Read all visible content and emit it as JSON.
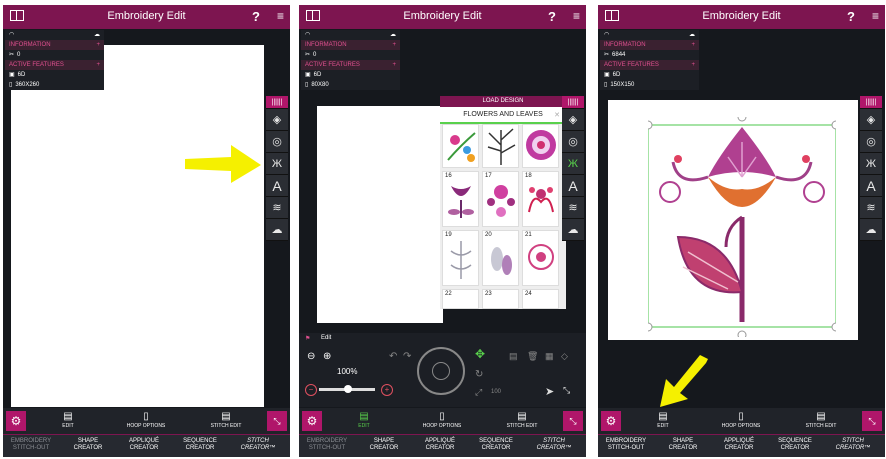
{
  "app": {
    "title": "Embroidery Edit",
    "help": "?",
    "menu": "≡"
  },
  "info_panel": {
    "information_label": "INFORMATION",
    "active_features_label": "ACTIVE FEATURES",
    "screens": [
      {
        "stitches": "0",
        "hoop_feature": "6D",
        "hoop_size": "360X260"
      },
      {
        "stitches": "0",
        "hoop_feature": "6D",
        "hoop_size": "80X80"
      },
      {
        "stitches": "6844",
        "hoop_feature": "6D",
        "hoop_size": "150X150"
      }
    ]
  },
  "load_design": {
    "header": "LOAD DESIGN",
    "category": "FLOWERS AND LEAVES",
    "cells": [
      "16",
      "17",
      "18",
      "19",
      "20",
      "21",
      "22",
      "23",
      "24"
    ]
  },
  "edit_panel": {
    "label": "Edit",
    "zoom": "100%",
    "minus": "−",
    "plus": "+",
    "hundred": "100"
  },
  "bottom_bar": {
    "edit": "EDIT",
    "hoop_options": "HOOP OPTIONS",
    "stitch_edit": "STITCH EDIT"
  },
  "nav": [
    {
      "line1": "EMBROIDERY",
      "line2": "STITCH-OUT"
    },
    {
      "line1": "SHAPE",
      "line2": "CREATOR"
    },
    {
      "line1": "APPLIQUÉ",
      "line2": "CREATOR"
    },
    {
      "line1": "SEQUENCE",
      "line2": "CREATOR"
    },
    {
      "line1": "STITCH",
      "line2": "CREATOR™"
    }
  ],
  "colors": {
    "brand": "#7d1550",
    "accent": "#b0166a",
    "active": "#59d14c",
    "annotation_arrow": "#f5f000"
  }
}
